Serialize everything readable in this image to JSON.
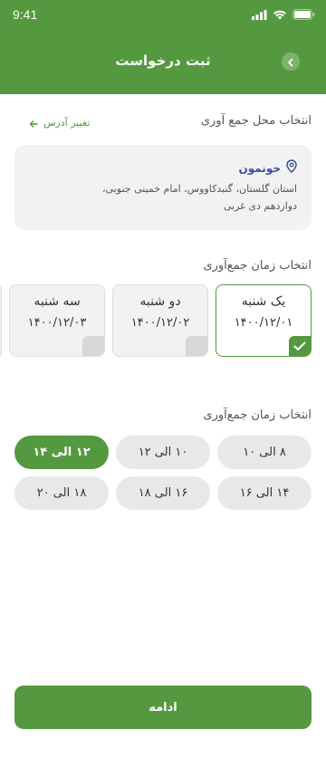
{
  "status_bar": {
    "time": "9:41",
    "icons": [
      "signal-icon",
      "wifi-icon",
      "battery-icon"
    ]
  },
  "header": {
    "title": "ثبت درخواست",
    "back_icon": "chevron-left-icon"
  },
  "location_section": {
    "label": "انتخاب محل جمع آوری",
    "change_address": "تغییر آدرس",
    "address": {
      "name": "خونمون",
      "line1": "استان گلستان، گنبدکاووس، امام خمینی جنوبی،",
      "line2": "دوازدهم دی غربی"
    }
  },
  "date_section": {
    "label": "انتخاب زمان جمع‌آوری",
    "days": [
      {
        "name": "یک شنبه",
        "date": "۱۴۰۰/۱۲/۰۱",
        "selected": true
      },
      {
        "name": "دو شنبه",
        "date": "۱۴۰۰/۱۲/۰۲",
        "selected": false
      },
      {
        "name": "سه شنبه",
        "date": "۱۴۰۰/۱۲/۰۳",
        "selected": false
      }
    ]
  },
  "time_section": {
    "label": "انتخاب زمان جمع‌آوری",
    "slots": [
      {
        "label": "۸ الی ۱۰",
        "selected": false
      },
      {
        "label": "۱۰ الی ۱۲",
        "selected": false
      },
      {
        "label": "۱۲ الی ۱۴",
        "selected": true
      },
      {
        "label": "۱۴ الی ۱۶",
        "selected": false
      },
      {
        "label": "۱۶ الی ۱۸",
        "selected": false
      },
      {
        "label": "۱۸ الی ۲۰",
        "selected": false
      }
    ]
  },
  "footer": {
    "continue_label": "ادامه"
  },
  "colors": {
    "primary": "#54993f",
    "card_bg": "#f2f2f2",
    "address_name": "#3a4f9c"
  }
}
